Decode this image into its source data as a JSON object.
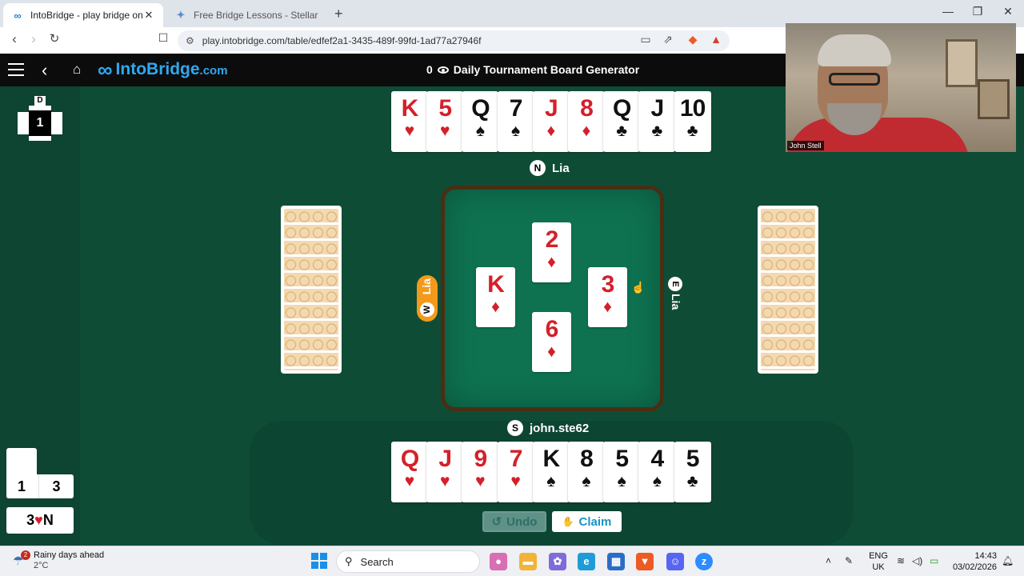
{
  "browser": {
    "tabs": [
      {
        "title": "IntoBridge - play bridge online",
        "active": true,
        "icon": "infinity-icon"
      },
      {
        "title": "Free Bridge Lessons - Stellar Bridge",
        "active": false,
        "icon": "stellar-icon"
      }
    ],
    "new_tab_symbol": "+",
    "url": "play.intobridge.com/table/edfef2a1-3435-489f-99fd-1ad77a27946f",
    "window_controls": [
      "—",
      "❐",
      "✕"
    ]
  },
  "app": {
    "brand": "IntoBridge",
    "brand_domain": ".com",
    "spectators": "0",
    "title": "Daily Tournament Board Generator",
    "accent_color": "#2fa9f0"
  },
  "board": {
    "dealer_label": "D",
    "board_number": "1"
  },
  "north": {
    "seat": "N",
    "player": "Lia",
    "cards": [
      {
        "rank": "K",
        "suit": "♥",
        "color": "red"
      },
      {
        "rank": "5",
        "suit": "♥",
        "color": "red"
      },
      {
        "rank": "Q",
        "suit": "♠",
        "color": "blk"
      },
      {
        "rank": "7",
        "suit": "♠",
        "color": "blk"
      },
      {
        "rank": "J",
        "suit": "♦",
        "color": "red"
      },
      {
        "rank": "8",
        "suit": "♦",
        "color": "red"
      },
      {
        "rank": "Q",
        "suit": "♣",
        "color": "blk"
      },
      {
        "rank": "J",
        "suit": "♣",
        "color": "blk"
      },
      {
        "rank": "10",
        "suit": "♣",
        "color": "blk"
      }
    ]
  },
  "west": {
    "seat": "W",
    "player": "Lia"
  },
  "east": {
    "seat": "E",
    "player": "Lia"
  },
  "south": {
    "seat": "S",
    "player": "john.ste62",
    "cards": [
      {
        "rank": "Q",
        "suit": "♥",
        "color": "red"
      },
      {
        "rank": "J",
        "suit": "♥",
        "color": "red"
      },
      {
        "rank": "9",
        "suit": "♥",
        "color": "red"
      },
      {
        "rank": "7",
        "suit": "♥",
        "color": "red"
      },
      {
        "rank": "K",
        "suit": "♠",
        "color": "blk"
      },
      {
        "rank": "8",
        "suit": "♠",
        "color": "blk"
      },
      {
        "rank": "5",
        "suit": "♠",
        "color": "blk"
      },
      {
        "rank": "4",
        "suit": "♠",
        "color": "blk"
      },
      {
        "rank": "5",
        "suit": "♣",
        "color": "blk"
      }
    ]
  },
  "trick": {
    "north": {
      "rank": "2",
      "suit": "♦"
    },
    "west": {
      "rank": "K",
      "suit": "♦"
    },
    "east": {
      "rank": "3",
      "suit": "♦"
    },
    "south": {
      "rank": "6",
      "suit": "♦"
    }
  },
  "score": {
    "tricks_ns": "1",
    "tricks_ew": "3",
    "contract_level": "3",
    "contract_suit": "♥",
    "contract_declarer": "N"
  },
  "actions": {
    "undo_label": "Undo",
    "claim_label": "Claim"
  },
  "webcam": {
    "name": "John Stell"
  },
  "taskbar": {
    "weather_title": "Rainy days ahead",
    "weather_temp": "2°C",
    "weather_badge": "2",
    "search_label": "Search",
    "lang_1": "ENG",
    "lang_2": "UK",
    "time": "14:43",
    "date": "03/02/2026"
  }
}
